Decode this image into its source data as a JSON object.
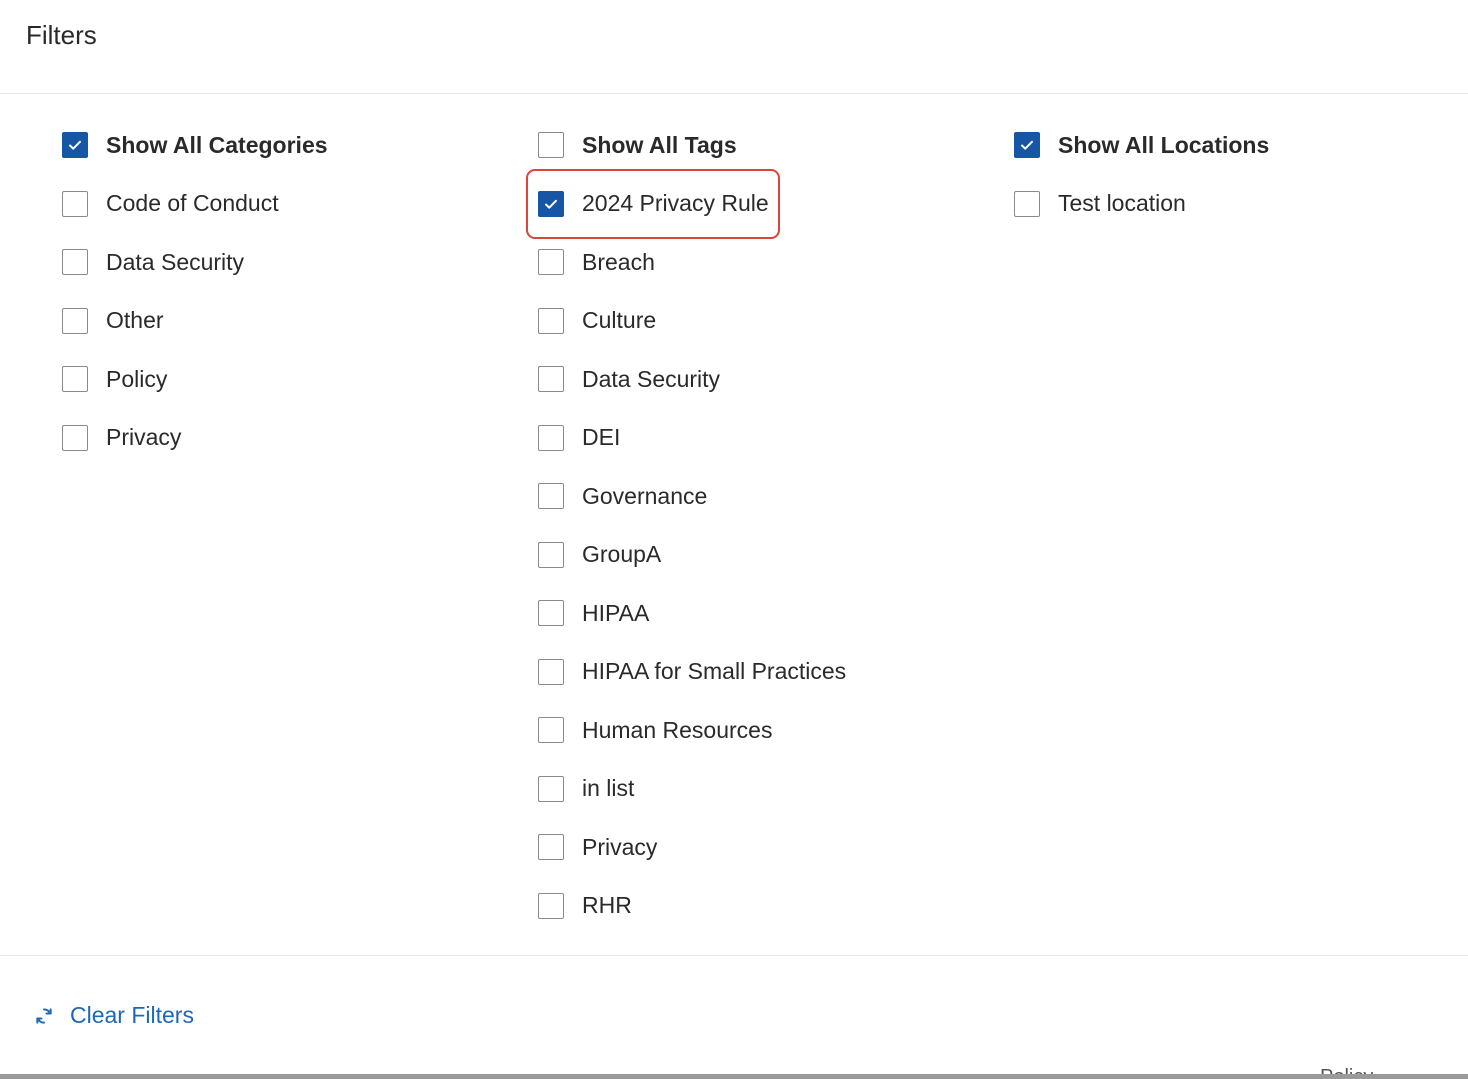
{
  "header": {
    "title": "Filters"
  },
  "categories": {
    "show_all": {
      "label": "Show All Categories",
      "checked": true
    },
    "items": [
      {
        "label": "Code of Conduct",
        "checked": false
      },
      {
        "label": "Data Security",
        "checked": false
      },
      {
        "label": "Other",
        "checked": false
      },
      {
        "label": "Policy",
        "checked": false
      },
      {
        "label": "Privacy",
        "checked": false
      }
    ]
  },
  "tags": {
    "show_all": {
      "label": "Show All Tags",
      "checked": false
    },
    "items": [
      {
        "label": "2024 Privacy Rule",
        "checked": true,
        "highlighted": true
      },
      {
        "label": "Breach",
        "checked": false
      },
      {
        "label": "Culture",
        "checked": false
      },
      {
        "label": "Data Security",
        "checked": false
      },
      {
        "label": "DEI",
        "checked": false
      },
      {
        "label": "Governance",
        "checked": false
      },
      {
        "label": "GroupA",
        "checked": false
      },
      {
        "label": "HIPAA",
        "checked": false
      },
      {
        "label": "HIPAA for Small Practices",
        "checked": false
      },
      {
        "label": "Human Resources",
        "checked": false
      },
      {
        "label": "in list",
        "checked": false
      },
      {
        "label": "Privacy",
        "checked": false
      },
      {
        "label": "RHR",
        "checked": false
      }
    ]
  },
  "locations": {
    "show_all": {
      "label": "Show All Locations",
      "checked": true
    },
    "items": [
      {
        "label": "Test location",
        "checked": false
      }
    ]
  },
  "footer": {
    "clear_label": "Clear Filters",
    "clear_icon": "refresh-icon"
  },
  "background_peek": {
    "label": "Policy"
  },
  "colors": {
    "accent": "#1756a5",
    "link": "#1d67b8",
    "highlight": "#d9473a"
  }
}
